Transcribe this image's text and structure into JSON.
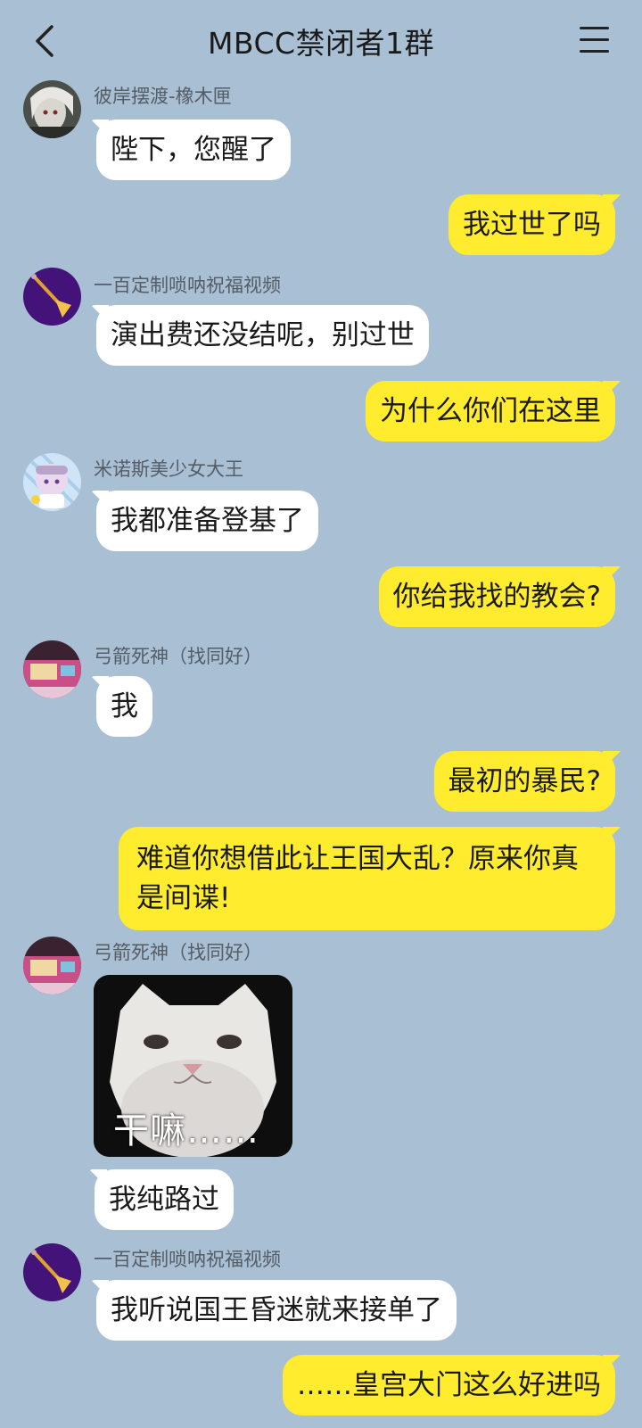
{
  "header": {
    "title": "MBCC禁闭者1群",
    "back_icon": "chevron-left-icon",
    "menu_icon": "hamburger-menu-icon"
  },
  "colors": {
    "background": "#a9bfd3",
    "incoming_bubble": "#ffffff",
    "outgoing_bubble": "#ffec2e"
  },
  "messages": [
    {
      "sender": "彼岸摆渡-橡木匣",
      "avatar_icon": "white-hair-character-avatar",
      "text": "陛下，您醒了"
    },
    {
      "outgoing": true,
      "text": "我过世了吗"
    },
    {
      "sender": "一百定制唢呐祝福视频",
      "avatar_icon": "suona-horn-avatar",
      "text": "演出费还没结呢，别过世"
    },
    {
      "outgoing": true,
      "text": "为什么你们在这里"
    },
    {
      "sender": "米诺斯美少女大王",
      "avatar_icon": "chibi-girl-avatar",
      "text": "我都准备登基了"
    },
    {
      "outgoing": true,
      "text": "你给我找的教会?"
    },
    {
      "sender": "弓箭死神（找同好）",
      "avatar_icon": "pink-room-avatar",
      "text": "我"
    },
    {
      "outgoing": true,
      "text": "最初的暴民?"
    },
    {
      "outgoing": true,
      "text": "难道你想借此让王国大乱？原来你真是间谍!"
    },
    {
      "sender": "弓箭死神（找同好）",
      "avatar_icon": "pink-room-avatar",
      "sticker_icon": "white-cat-sticker",
      "sticker_caption": "干嘛……",
      "text": "我纯路过"
    },
    {
      "sender": "一百定制唢呐祝福视频",
      "avatar_icon": "suona-horn-avatar",
      "text": "我听说国王昏迷就来接单了"
    },
    {
      "outgoing": true,
      "text": "……皇宫大门这么好进吗"
    }
  ]
}
